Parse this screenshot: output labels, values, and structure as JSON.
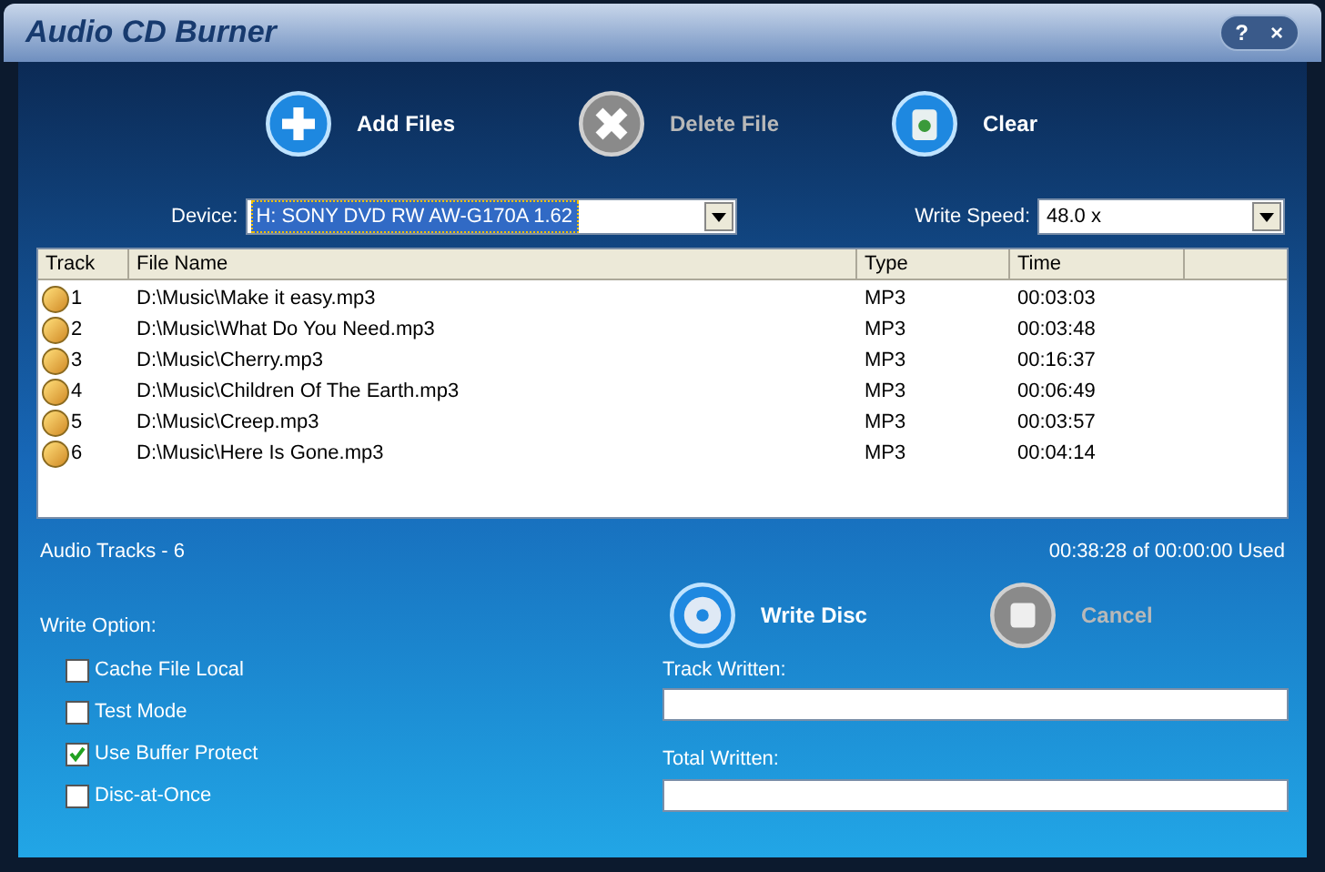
{
  "window": {
    "title": "Audio CD Burner",
    "title_buttons": [
      "?",
      "×"
    ]
  },
  "toolbar": [
    {
      "kind": "add",
      "label": "Add Files",
      "disabled": false
    },
    {
      "kind": "delete",
      "label": "Delete File",
      "disabled": true
    },
    {
      "kind": "clear",
      "label": "Clear",
      "disabled": false
    }
  ],
  "device": {
    "label": "Device:",
    "value": "H: SONY DVD RW AW-G170A 1.62"
  },
  "write_speed": {
    "label": "Write Speed:",
    "value": "48.0 x"
  },
  "table": {
    "columns": [
      "Track",
      "File Name",
      "Type",
      "Time"
    ],
    "rows": [
      {
        "track": "1",
        "file": "D:\\Music\\Make it easy.mp3",
        "type": "MP3",
        "time": "00:03:03"
      },
      {
        "track": "2",
        "file": "D:\\Music\\What Do You Need.mp3",
        "type": "MP3",
        "time": "00:03:48"
      },
      {
        "track": "3",
        "file": "D:\\Music\\Cherry.mp3",
        "type": "MP3",
        "time": "00:16:37"
      },
      {
        "track": "4",
        "file": "D:\\Music\\Children Of The Earth.mp3",
        "type": "MP3",
        "time": "00:06:49"
      },
      {
        "track": "5",
        "file": "D:\\Music\\Creep.mp3",
        "type": "MP3",
        "time": "00:03:57"
      },
      {
        "track": "6",
        "file": "D:\\Music\\Here Is Gone.mp3",
        "type": "MP3",
        "time": "00:04:14"
      }
    ]
  },
  "status": {
    "tracks": "Audio Tracks -  6",
    "used": "00:38:28 of 00:00:00 Used"
  },
  "write_options": {
    "label": "Write Option:",
    "items": [
      {
        "label": "Cache File Local",
        "checked": false
      },
      {
        "label": "Test Mode",
        "checked": false
      },
      {
        "label": "Use Buffer Protect",
        "checked": true
      },
      {
        "label": "Disc-at-Once",
        "checked": false
      }
    ]
  },
  "actions": [
    {
      "kind": "write",
      "label": "Write Disc",
      "disabled": false
    },
    {
      "kind": "cancel",
      "label": "Cancel",
      "disabled": true
    }
  ],
  "progress": [
    {
      "label": "Track Written:",
      "level": 0
    },
    {
      "label": "Total Written:",
      "level": 0
    }
  ]
}
